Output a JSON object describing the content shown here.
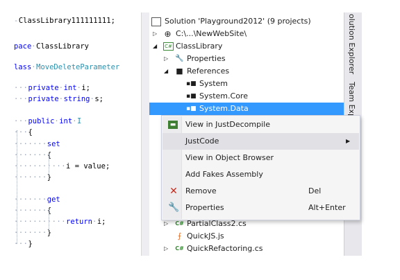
{
  "code": {
    "line1": "ClassLibrary111111111;",
    "line2_kw": "pace",
    "line2_name": "ClassLibrary",
    "line3_kw": "lass",
    "line3_name": "MoveDeleteParameter",
    "line4_kw1": "private",
    "line4_kw2": "int",
    "line4_name": "i;",
    "line5_kw1": "private",
    "line5_kw2": "string",
    "line5_name": "s;",
    "line6_kw1": "public",
    "line6_kw2": "int",
    "line6_name": "I",
    "brace_open": "{",
    "set_kw": "set",
    "assign": "i = value;",
    "brace_close": "}",
    "get_kw": "get",
    "return_kw": "return",
    "return_val": "i;"
  },
  "solution_explorer": {
    "items": [
      {
        "label": "Solution 'Playground2012' (9 projects)",
        "icon": "solution-icon"
      },
      {
        "label": "C:\\...\\NewWebSite\\",
        "icon": "globe-icon"
      },
      {
        "label": "ClassLibrary",
        "icon": "csharp-project-icon"
      },
      {
        "label": "Properties",
        "icon": "wrench-icon"
      },
      {
        "label": "References",
        "icon": "references-icon"
      },
      {
        "label": "System",
        "icon": "reference-icon"
      },
      {
        "label": "System.Core",
        "icon": "reference-icon"
      },
      {
        "label": "System.Data",
        "icon": "reference-icon"
      },
      {
        "label": "PartialClass2.cs",
        "icon": "csharp-file-icon"
      },
      {
        "label": "QuickJS.js",
        "icon": "js-file-icon"
      },
      {
        "label": "QuickRefactoring.cs",
        "icon": "csharp-file-icon"
      }
    ],
    "partial_text": [
      "S",
      "P",
      "M",
      "C",
      "C"
    ]
  },
  "side_tabs": {
    "explorer": "olution Explorer",
    "team": "Team Exp"
  },
  "context_menu": {
    "items": [
      {
        "label": "View in JustDecompile",
        "shortcut": "",
        "icon": "justdecompile-icon"
      },
      {
        "label": "JustCode",
        "shortcut": "",
        "icon": ""
      },
      {
        "label": "View in Object Browser",
        "shortcut": "",
        "icon": ""
      },
      {
        "label": "Add Fakes Assembly",
        "shortcut": "",
        "icon": ""
      },
      {
        "label": "Remove",
        "shortcut": "Del",
        "icon": "remove-x-icon"
      },
      {
        "label": "Properties",
        "shortcut": "Alt+Enter",
        "icon": "wrench-icon"
      }
    ]
  },
  "colors": {
    "selection": "#3399ff",
    "keyword": "#0000ff",
    "type": "#2b91af",
    "remove_icon": "#c42b1c",
    "csharp_icon": "#388a34",
    "js_icon": "#e8702a"
  }
}
